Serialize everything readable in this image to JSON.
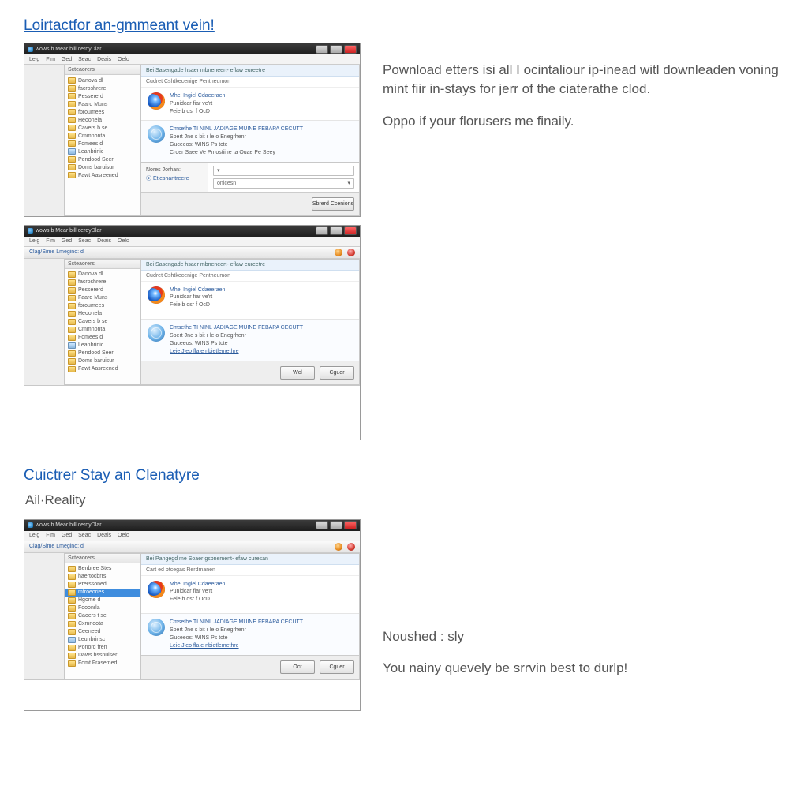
{
  "section1": {
    "heading": "Loirtactfor an-gmmeant vein!",
    "paragraph1": "Pownload etters isi all I ocintaliour ip-inead witl downleaden voning mint fiir in-stays for jerr of the ciaterathe clod.",
    "paragraph2": "Oppo if your florusers me finaily."
  },
  "section2": {
    "heading": "Cuictrer Stay an Clenatyre",
    "subhead": "Ail·Reality",
    "paragraph1": "Noushed : sly",
    "paragraph2": "You nainy quevely be srrvin best to durlp!"
  },
  "win": {
    "title": "wows b Mear bill cerdyDlar",
    "menus": [
      "Leig",
      "Flm",
      "Ged",
      "Seac",
      "Deais",
      "Oelc"
    ],
    "toolbar_left": "Clag/Sime  Lmegino: d",
    "sidebar_header": "Scteaorers",
    "main_header_a": "Bei  Sasengade hsaer mbneneert- eflaw eureetre",
    "main_header_b": "Bei  Pangegd me Soaer gsbnement- efaw curesan",
    "crumb": "Cudret Cshtkecenige Pentheumon",
    "crumb2": "Cart ed btcegas Rerdmanen",
    "file1_name": "Mhei Ingiel Cdaeeraen",
    "file1_l2": "Punidcar fiar ve'rt",
    "file1_l3": "Feie b osr f OcD",
    "file2_name": "Cmsethe  TI  NINL  JADIAGE MUINE  FEBAPA CECUTT",
    "file2_l2": "Spert Jne s bit r le o Enegrhenr",
    "file2_l3": "Guceeos: WINS Ps tcte",
    "file2_l4": "Croer Saee Ve  Pmostiine ta Ouae Pe Seey",
    "file2b_l3": "Leie Jieo fla e nbietlemethre",
    "label_name": "Nores Jorhan:",
    "label_type": "Etieshantreere",
    "field_type_val": "onicesn",
    "btn_ok": "Wcl",
    "btn_ok2": "Ocr",
    "btn_cancel": "Cguer",
    "btn_run": "Sbrerd Ccenions",
    "tree": [
      {
        "t": "Danova  dl",
        "ic": "folder"
      },
      {
        "t": "facroshrere",
        "ic": "folder"
      },
      {
        "t": "Pessererd",
        "ic": "folder"
      },
      {
        "t": "Faard Muns",
        "ic": "folder"
      },
      {
        "t": "fbroumees",
        "ic": "folder"
      },
      {
        "t": "Heoonela",
        "ic": "folder"
      },
      {
        "t": "Cavers b se",
        "ic": "folder"
      },
      {
        "t": "Cmmnonta",
        "ic": "folder"
      },
      {
        "t": "Fomees d",
        "ic": "folder"
      },
      {
        "t": "Leanbrinic",
        "ic": "drive"
      },
      {
        "t": "Pendood Seer",
        "ic": "folder"
      },
      {
        "t": "Doms baruisur",
        "ic": "folder"
      },
      {
        "t": "Fawt  Aasreened",
        "ic": "folder"
      }
    ],
    "tree_b": [
      {
        "t": "Benbree Stes",
        "ic": "folder"
      },
      {
        "t": "haertocbrrs",
        "ic": "folder"
      },
      {
        "t": "Prerssoned",
        "ic": "folder"
      },
      {
        "t": "mfroeories",
        "ic": "folder",
        "sel": true
      },
      {
        "t": "Hgome d",
        "ic": "folder"
      },
      {
        "t": "Fooonrla",
        "ic": "folder"
      },
      {
        "t": "Caoers t se",
        "ic": "folder"
      },
      {
        "t": "Cxmnoota",
        "ic": "folder"
      },
      {
        "t": "Ceeneed",
        "ic": "folder"
      },
      {
        "t": "Leunbrinsc",
        "ic": "drive"
      },
      {
        "t": "Ponord fren",
        "ic": "folder"
      },
      {
        "t": "Daws bssnuiser",
        "ic": "folder"
      },
      {
        "t": "Fomt  Frasemed",
        "ic": "folder"
      }
    ]
  }
}
